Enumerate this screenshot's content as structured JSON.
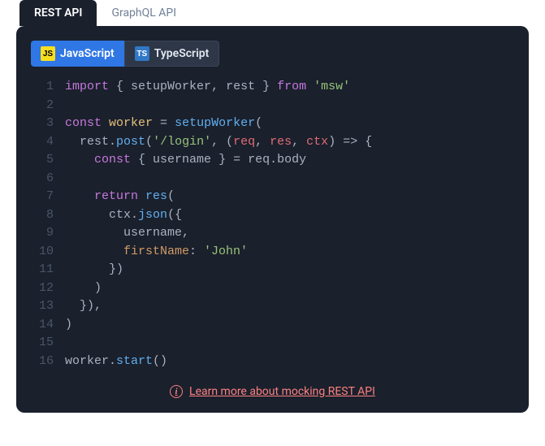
{
  "apiTabs": {
    "rest": "REST API",
    "graphql": "GraphQL API"
  },
  "langTabs": {
    "js": "JavaScript",
    "ts": "TypeScript",
    "jsIcon": "JS",
    "tsIcon": "TS"
  },
  "code": {
    "lines": [
      [
        [
          "kw",
          "import"
        ],
        [
          "punc",
          " { "
        ],
        [
          "id",
          "setupWorker"
        ],
        [
          "punc",
          ", "
        ],
        [
          "id",
          "rest"
        ],
        [
          "punc",
          " } "
        ],
        [
          "kw",
          "from"
        ],
        [
          "punc",
          " "
        ],
        [
          "str",
          "'msw'"
        ]
      ],
      [],
      [
        [
          "kw",
          "const"
        ],
        [
          "punc",
          " "
        ],
        [
          "plain",
          "worker"
        ],
        [
          "punc",
          " = "
        ],
        [
          "fn",
          "setupWorker"
        ],
        [
          "punc",
          "("
        ]
      ],
      [
        [
          "punc",
          "  "
        ],
        [
          "id",
          "rest"
        ],
        [
          "punc",
          "."
        ],
        [
          "fn",
          "post"
        ],
        [
          "punc",
          "("
        ],
        [
          "str",
          "'/login'"
        ],
        [
          "punc",
          ", ("
        ],
        [
          "var",
          "req"
        ],
        [
          "punc",
          ", "
        ],
        [
          "var",
          "res"
        ],
        [
          "punc",
          ", "
        ],
        [
          "var",
          "ctx"
        ],
        [
          "punc",
          ") => {"
        ]
      ],
      [
        [
          "punc",
          "    "
        ],
        [
          "kw",
          "const"
        ],
        [
          "punc",
          " { "
        ],
        [
          "id",
          "username"
        ],
        [
          "punc",
          " } = "
        ],
        [
          "id",
          "req"
        ],
        [
          "punc",
          "."
        ],
        [
          "id",
          "body"
        ]
      ],
      [],
      [
        [
          "punc",
          "    "
        ],
        [
          "kw",
          "return"
        ],
        [
          "punc",
          " "
        ],
        [
          "fn",
          "res"
        ],
        [
          "punc",
          "("
        ]
      ],
      [
        [
          "punc",
          "      "
        ],
        [
          "id",
          "ctx"
        ],
        [
          "punc",
          "."
        ],
        [
          "fn",
          "json"
        ],
        [
          "punc",
          "({"
        ]
      ],
      [
        [
          "punc",
          "        "
        ],
        [
          "id",
          "username"
        ],
        [
          "punc",
          ","
        ]
      ],
      [
        [
          "punc",
          "        "
        ],
        [
          "prop",
          "firstName"
        ],
        [
          "punc",
          ": "
        ],
        [
          "str",
          "'John'"
        ]
      ],
      [
        [
          "punc",
          "      })"
        ]
      ],
      [
        [
          "punc",
          "    )"
        ]
      ],
      [
        [
          "punc",
          "  }),"
        ]
      ],
      [
        [
          "punc",
          ")"
        ]
      ],
      [],
      [
        [
          "id",
          "worker"
        ],
        [
          "punc",
          "."
        ],
        [
          "fn",
          "start"
        ],
        [
          "punc",
          "()"
        ]
      ]
    ]
  },
  "footer": {
    "link": "Learn more about mocking REST API",
    "infoGlyph": "i"
  }
}
